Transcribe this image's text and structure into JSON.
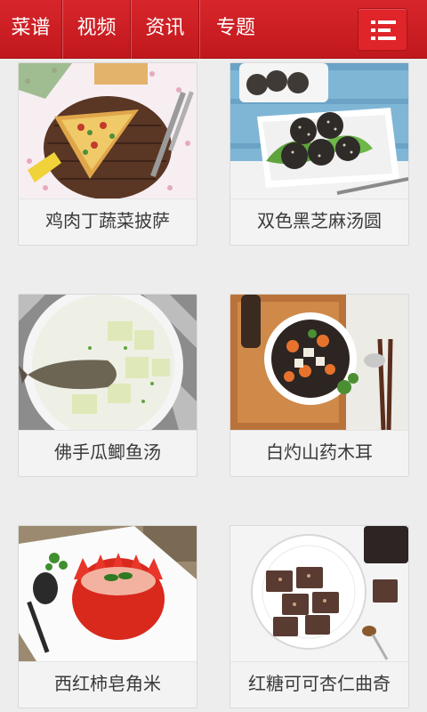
{
  "nav": {
    "tabs": [
      {
        "label": "菜谱"
      },
      {
        "label": "视频"
      },
      {
        "label": "资讯"
      },
      {
        "label": "专题"
      }
    ],
    "menu_icon": "menu-list-icon"
  },
  "recipes": [
    {
      "title": "鸡肉丁蔬菜披萨",
      "image": "pizza-photo"
    },
    {
      "title": "双色黑芝麻汤圆",
      "image": "sesame-balls-photo"
    },
    {
      "title": "佛手瓜鲫鱼汤",
      "image": "fish-soup-photo"
    },
    {
      "title": "白灼山药木耳",
      "image": "yam-fungus-photo"
    },
    {
      "title": "西红柿皂角米",
      "image": "tomato-dessert-photo"
    },
    {
      "title": "红糖可可杏仁曲奇",
      "image": "cocoa-cookies-photo"
    }
  ],
  "colors": {
    "header": "#d7262b",
    "background": "#ededed",
    "card": "#f3f3f3",
    "text": "#3a3a3a"
  }
}
